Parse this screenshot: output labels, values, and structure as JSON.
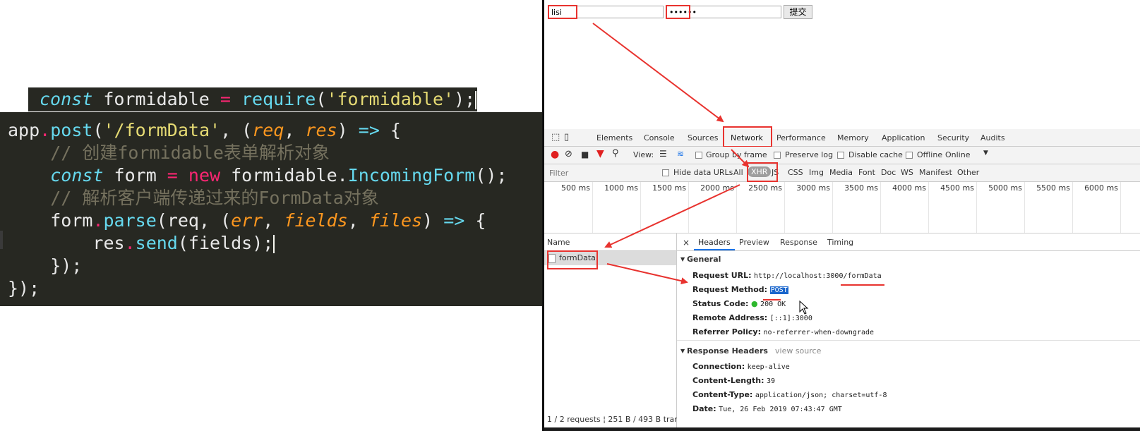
{
  "code_top": {
    "kw": "const",
    "name": " formidable ",
    "eq": "=",
    "fn": " require",
    "open": "(",
    "str": "'formidable'",
    "close": ");"
  },
  "code_main": {
    "l1_app": "app",
    "l1_dot": ".",
    "l1_fn": "post",
    "l1_open": "(",
    "l1_str": "'/formData'",
    "l1_mid": ", (",
    "l1_p1": "req",
    "l1_comma": ", ",
    "l1_p2": "res",
    "l1_close": ") ",
    "l1_arrow": "=>",
    "l1_brace": " {",
    "l2_comment": "    // 创建formidable表单解析对象",
    "l3_indent": "    ",
    "l3_kw": "const",
    "l3_name": " form ",
    "l3_eq": "=",
    "l3_new": " new",
    "l3_obj": " formidable.",
    "l3_fn": "IncomingForm",
    "l3_end": "();",
    "l4_comment": "    // 解析客户端传递过来的FormData对象",
    "l5_indent": "    ",
    "l5_obj": "form",
    "l5_dot": ".",
    "l5_fn": "parse",
    "l5_open": "(req, (",
    "l5_p1": "err",
    "l5_c1": ", ",
    "l5_p2": "fields",
    "l5_c2": ", ",
    "l5_p3": "files",
    "l5_close": ") ",
    "l5_arrow": "=>",
    "l5_brace": " {",
    "l6_indent": "        ",
    "l6_obj": "res",
    "l6_dot": ".",
    "l6_fn": "send",
    "l6_end": "(fields);",
    "l7": "    });",
    "l8": "});"
  },
  "form": {
    "username_value": "lisi",
    "password_value": "••••••",
    "submit_label": "提交"
  },
  "devtools": {
    "tabs": [
      "Elements",
      "Console",
      "Sources",
      "Network",
      "Performance",
      "Memory",
      "Application",
      "Security",
      "Audits"
    ],
    "active_tab": "Network",
    "toolbar": {
      "view_label": "View:",
      "group_by_frame": "Group by frame",
      "preserve_log": "Preserve log",
      "disable_cache": "Disable cache",
      "offline": "Offline",
      "online": "Online"
    },
    "filter": {
      "placeholder": "Filter",
      "hide_data_urls": "Hide data URLs",
      "types": [
        "All",
        "XHR",
        "JS",
        "CSS",
        "Img",
        "Media",
        "Font",
        "Doc",
        "WS",
        "Manifest",
        "Other"
      ],
      "active_type": "XHR"
    },
    "timeline_ticks": [
      "500 ms",
      "1000 ms",
      "1500 ms",
      "2000 ms",
      "2500 ms",
      "3000 ms",
      "3500 ms",
      "4000 ms",
      "4500 ms",
      "5000 ms",
      "5500 ms",
      "6000 ms"
    ],
    "name_header": "Name",
    "requests": [
      "formData"
    ],
    "status_bar": "1 / 2 requests ¦ 251 B / 493 B tran...",
    "detail_tabs": [
      "Headers",
      "Preview",
      "Response",
      "Timing"
    ],
    "active_detail_tab": "Headers",
    "general": {
      "title": "General",
      "request_url_label": "Request URL:",
      "request_url_value": "http://localhost:3000/formData",
      "request_method_label": "Request Method:",
      "request_method_value": "POST",
      "status_code_label": "Status Code:",
      "status_code_value": "200 OK",
      "remote_address_label": "Remote Address:",
      "remote_address_value": "[::1]:3000",
      "referrer_policy_label": "Referrer Policy:",
      "referrer_policy_value": "no-referrer-when-downgrade"
    },
    "response_headers": {
      "title": "Response Headers",
      "view_source": "view source",
      "connection_label": "Connection:",
      "connection_value": "keep-alive",
      "content_length_label": "Content-Length:",
      "content_length_value": "39",
      "content_type_label": "Content-Type:",
      "content_type_value": "application/json; charset=utf-8",
      "date_label": "Date:",
      "date_value": "Tue, 26 Feb 2019 07:43:47 GMT"
    }
  },
  "colors": {
    "annotation_red": "#e8332f",
    "editor_bg": "#272822",
    "status_green": "#2eb82e",
    "devtools_blue": "#1a73e8"
  }
}
